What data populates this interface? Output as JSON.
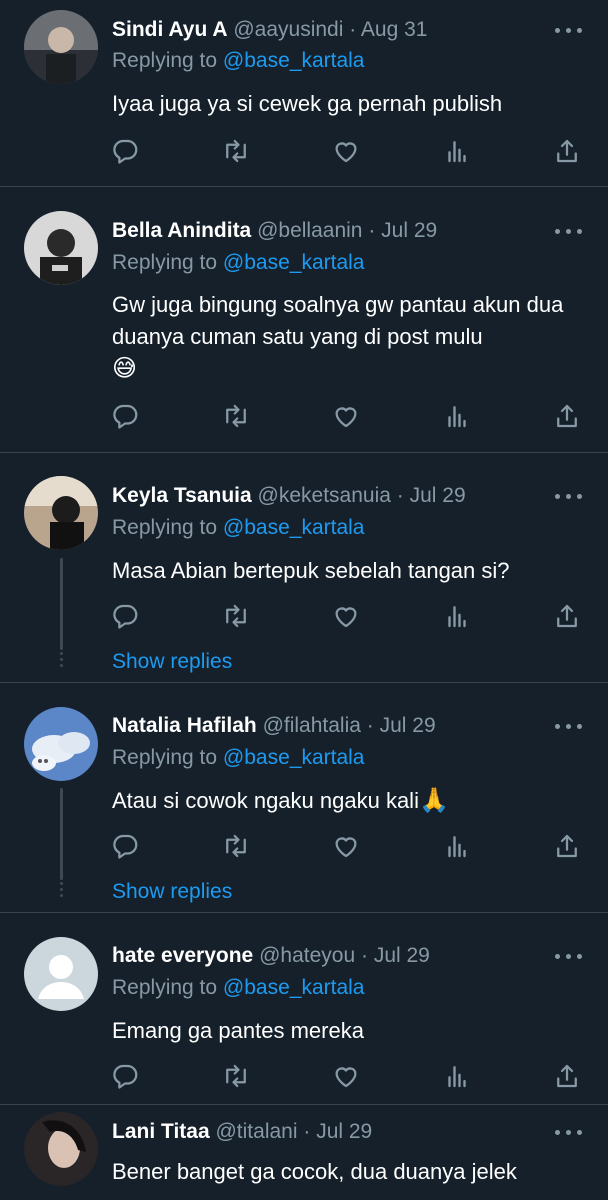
{
  "mention": "@base_kartala",
  "replying_prefix": "Replying to ",
  "show_replies_label": "Show replies",
  "colors": {
    "background": "#15202b",
    "accent": "#1d9bf0",
    "muted": "#8899a6",
    "divider": "#38444d"
  },
  "tweets": [
    {
      "name": "Sindi Ayu A",
      "handle": "@aayusindi",
      "date": "Aug 31",
      "text": "Iyaa juga ya si cewek ga pernah publish"
    },
    {
      "name": "Bella Anindita",
      "handle": "@bellaanin",
      "date": "Jul 29",
      "text": "Gw juga bingung soalnya gw pantau akun dua duanya cuman satu yang di post mulu",
      "emoji": "😅"
    },
    {
      "name": "Keyla Tsanuia",
      "handle": "@keketsanuia",
      "date": "Jul 29",
      "text": "Masa Abian bertepuk sebelah tangan si?"
    },
    {
      "name": "Natalia Hafilah",
      "handle": "@filahtalia",
      "date": "Jul 29",
      "text": "Atau si cowok ngaku ngaku kali",
      "emoji": "🙏"
    },
    {
      "name": "hate everyone",
      "handle": "@hateyou",
      "date": "Jul 29",
      "text": "Emang ga pantes mereka"
    },
    {
      "name": "Lani Titaa",
      "handle": "@titalani",
      "date": "Jul 29",
      "text": "Bener banget ga cocok, dua duanya jelek"
    }
  ],
  "action_icons": [
    "reply-icon",
    "retweet-icon",
    "like-icon",
    "analytics-icon",
    "share-icon"
  ],
  "sep": " · "
}
